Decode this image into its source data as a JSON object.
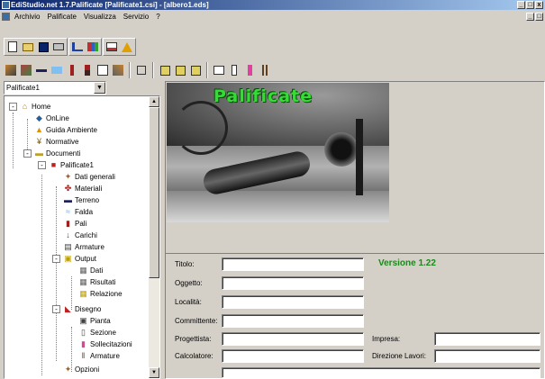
{
  "window": {
    "title": "EdiStudio.net 1.7.Palificate [Palificate1.csi] - [albero1.eds]",
    "min": "_",
    "max": "□",
    "close": "x"
  },
  "menu": {
    "items": [
      "Archivio",
      "Palificate",
      "Visualizza",
      "Servizio",
      "?"
    ]
  },
  "toolbar1": {
    "icons": [
      "new-icon",
      "open-icon",
      "save-icon",
      "print-icon",
      "tree-icon",
      "chart-icon",
      "preview-icon",
      "alert-icon"
    ]
  },
  "toolbar2": {
    "icons": [
      "pile-settings-icon",
      "material-icon",
      "terrain-icon",
      "water-icon",
      "pile-icon",
      "load-icon",
      "chart-icon",
      "tools-icon",
      "stop-icon",
      "grid-icon",
      "grid-icon",
      "grid-icon",
      "view-icon",
      "section-icon",
      "stress-icon",
      "rebar-icon"
    ]
  },
  "combo": {
    "value": "Palificate1",
    "arrow": "▼"
  },
  "tree": {
    "home": "Home",
    "online": "OnLine",
    "guida": "Guida Ambiente",
    "normative": "Normative",
    "documenti": "Documenti",
    "palificate1": "Palificate1",
    "dati_generali": "Dati generali",
    "materiali": "Materiali",
    "terreno": "Terreno",
    "falda": "Falda",
    "pali": "Pali",
    "carichi": "Carichi",
    "armature": "Armature",
    "output": "Output",
    "dati": "Dati",
    "risultati": "Risultati",
    "relazione": "Relazione",
    "disegno": "Disegno",
    "pianta": "Pianta",
    "sezione": "Sezione",
    "sollecitazioni": "Sollecitazioni",
    "armature2": "Armature",
    "opzioni": "Opzioni"
  },
  "banner": {
    "title": "Palificate"
  },
  "form": {
    "version": "Versione 1.22",
    "titolo": "Titolo:",
    "oggetto": "Oggetto:",
    "localita": "Località:",
    "committente": "Committente:",
    "progettista": "Progettista:",
    "calcolatore": "Calcolatore:",
    "impresa": "Impresa:",
    "direzione": "Direzione Lavori:"
  }
}
